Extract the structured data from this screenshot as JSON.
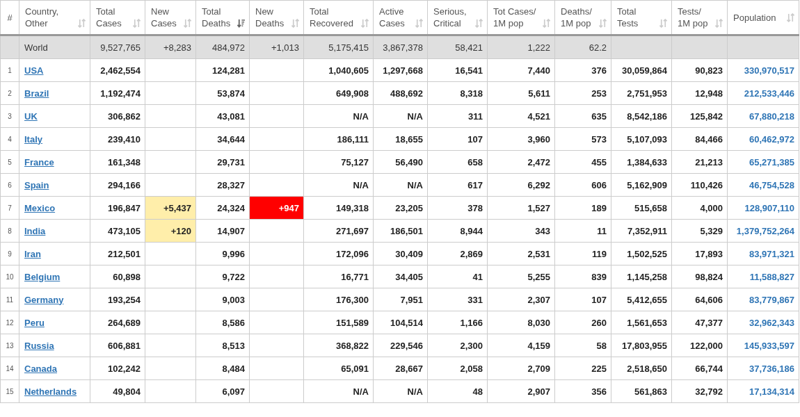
{
  "table": {
    "columns": [
      {
        "label": "#"
      },
      {
        "label": "Country,\nOther",
        "sorted": false
      },
      {
        "label": "Total\nCases",
        "sorted": false
      },
      {
        "label": "New\nCases",
        "sorted": false
      },
      {
        "label": "Total\nDeaths",
        "sorted": true
      },
      {
        "label": "New\nDeaths",
        "sorted": false
      },
      {
        "label": "Total\nRecovered",
        "sorted": false
      },
      {
        "label": "Active\nCases",
        "sorted": false
      },
      {
        "label": "Serious,\nCritical",
        "sorted": false
      },
      {
        "label": "Tot Cases/\n1M pop",
        "sorted": false
      },
      {
        "label": "Deaths/\n1M pop",
        "sorted": false
      },
      {
        "label": "Total\nTests",
        "sorted": false
      },
      {
        "label": "Tests/\n1M pop",
        "sorted": false
      },
      {
        "label": "Population",
        "sorted": false
      }
    ],
    "rows": [
      {
        "kind": "total",
        "country": "World",
        "total_cases": "9,527,765",
        "new_cases": "+8,283",
        "total_deaths": "484,972",
        "new_deaths": "+1,013",
        "total_recovered": "5,175,415",
        "active_cases": "3,867,378",
        "serious_critical": "58,421",
        "cases_per_1m": "1,222",
        "deaths_per_1m": "62.2"
      },
      {
        "kind": "country",
        "rank": "1",
        "country": "USA",
        "total_cases": "2,462,554",
        "total_deaths": "124,281",
        "total_recovered": "1,040,605",
        "active_cases": "1,297,668",
        "serious_critical": "16,541",
        "cases_per_1m": "7,440",
        "deaths_per_1m": "376",
        "total_tests": "30,059,864",
        "tests_per_1m": "90,823",
        "population": "330,970,517",
        "new_cases_highlight": false,
        "new_deaths_highlight": false
      },
      {
        "kind": "country",
        "rank": "2",
        "country": "Brazil",
        "total_cases": "1,192,474",
        "total_deaths": "53,874",
        "total_recovered": "649,908",
        "active_cases": "488,692",
        "serious_critical": "8,318",
        "cases_per_1m": "5,611",
        "deaths_per_1m": "253",
        "total_tests": "2,751,953",
        "tests_per_1m": "12,948",
        "population": "212,533,446",
        "new_cases_highlight": false,
        "new_deaths_highlight": false
      },
      {
        "kind": "country",
        "rank": "3",
        "country": "UK",
        "total_cases": "306,862",
        "total_deaths": "43,081",
        "total_recovered": "N/A",
        "active_cases": "N/A",
        "serious_critical": "311",
        "cases_per_1m": "4,521",
        "deaths_per_1m": "635",
        "total_tests": "8,542,186",
        "tests_per_1m": "125,842",
        "population": "67,880,218",
        "new_cases_highlight": false,
        "new_deaths_highlight": false
      },
      {
        "kind": "country",
        "rank": "4",
        "country": "Italy",
        "total_cases": "239,410",
        "total_deaths": "34,644",
        "total_recovered": "186,111",
        "active_cases": "18,655",
        "serious_critical": "107",
        "cases_per_1m": "3,960",
        "deaths_per_1m": "573",
        "total_tests": "5,107,093",
        "tests_per_1m": "84,466",
        "population": "60,462,972",
        "new_cases_highlight": false,
        "new_deaths_highlight": false
      },
      {
        "kind": "country",
        "rank": "5",
        "country": "France",
        "total_cases": "161,348",
        "total_deaths": "29,731",
        "total_recovered": "75,127",
        "active_cases": "56,490",
        "serious_critical": "658",
        "cases_per_1m": "2,472",
        "deaths_per_1m": "455",
        "total_tests": "1,384,633",
        "tests_per_1m": "21,213",
        "population": "65,271,385",
        "new_cases_highlight": false,
        "new_deaths_highlight": false
      },
      {
        "kind": "country",
        "rank": "6",
        "country": "Spain",
        "total_cases": "294,166",
        "total_deaths": "28,327",
        "total_recovered": "N/A",
        "active_cases": "N/A",
        "serious_critical": "617",
        "cases_per_1m": "6,292",
        "deaths_per_1m": "606",
        "total_tests": "5,162,909",
        "tests_per_1m": "110,426",
        "population": "46,754,528",
        "new_cases_highlight": false,
        "new_deaths_highlight": false
      },
      {
        "kind": "country",
        "rank": "7",
        "country": "Mexico",
        "total_cases": "196,847",
        "new_cases": "+5,437",
        "total_deaths": "24,324",
        "new_deaths": "+947",
        "total_recovered": "149,318",
        "active_cases": "23,205",
        "serious_critical": "378",
        "cases_per_1m": "1,527",
        "deaths_per_1m": "189",
        "total_tests": "515,658",
        "tests_per_1m": "4,000",
        "population": "128,907,110",
        "new_cases_highlight": true,
        "new_deaths_highlight": true
      },
      {
        "kind": "country",
        "rank": "8",
        "country": "India",
        "total_cases": "473,105",
        "new_cases": "+120",
        "total_deaths": "14,907",
        "total_recovered": "271,697",
        "active_cases": "186,501",
        "serious_critical": "8,944",
        "cases_per_1m": "343",
        "deaths_per_1m": "11",
        "total_tests": "7,352,911",
        "tests_per_1m": "5,329",
        "population": "1,379,752,264",
        "new_cases_highlight": true,
        "new_deaths_highlight": false
      },
      {
        "kind": "country",
        "rank": "9",
        "country": "Iran",
        "total_cases": "212,501",
        "total_deaths": "9,996",
        "total_recovered": "172,096",
        "active_cases": "30,409",
        "serious_critical": "2,869",
        "cases_per_1m": "2,531",
        "deaths_per_1m": "119",
        "total_tests": "1,502,525",
        "tests_per_1m": "17,893",
        "population": "83,971,321",
        "new_cases_highlight": false,
        "new_deaths_highlight": false
      },
      {
        "kind": "country",
        "rank": "10",
        "country": "Belgium",
        "total_cases": "60,898",
        "total_deaths": "9,722",
        "total_recovered": "16,771",
        "active_cases": "34,405",
        "serious_critical": "41",
        "cases_per_1m": "5,255",
        "deaths_per_1m": "839",
        "total_tests": "1,145,258",
        "tests_per_1m": "98,824",
        "population": "11,588,827",
        "new_cases_highlight": false,
        "new_deaths_highlight": false
      },
      {
        "kind": "country",
        "rank": "11",
        "country": "Germany",
        "total_cases": "193,254",
        "total_deaths": "9,003",
        "total_recovered": "176,300",
        "active_cases": "7,951",
        "serious_critical": "331",
        "cases_per_1m": "2,307",
        "deaths_per_1m": "107",
        "total_tests": "5,412,655",
        "tests_per_1m": "64,606",
        "population": "83,779,867",
        "new_cases_highlight": false,
        "new_deaths_highlight": false
      },
      {
        "kind": "country",
        "rank": "12",
        "country": "Peru",
        "total_cases": "264,689",
        "total_deaths": "8,586",
        "total_recovered": "151,589",
        "active_cases": "104,514",
        "serious_critical": "1,166",
        "cases_per_1m": "8,030",
        "deaths_per_1m": "260",
        "total_tests": "1,561,653",
        "tests_per_1m": "47,377",
        "population": "32,962,343",
        "new_cases_highlight": false,
        "new_deaths_highlight": false
      },
      {
        "kind": "country",
        "rank": "13",
        "country": "Russia",
        "total_cases": "606,881",
        "total_deaths": "8,513",
        "total_recovered": "368,822",
        "active_cases": "229,546",
        "serious_critical": "2,300",
        "cases_per_1m": "4,159",
        "deaths_per_1m": "58",
        "total_tests": "17,803,955",
        "tests_per_1m": "122,000",
        "population": "145,933,597",
        "new_cases_highlight": false,
        "new_deaths_highlight": false
      },
      {
        "kind": "country",
        "rank": "14",
        "country": "Canada",
        "total_cases": "102,242",
        "total_deaths": "8,484",
        "total_recovered": "65,091",
        "active_cases": "28,667",
        "serious_critical": "2,058",
        "cases_per_1m": "2,709",
        "deaths_per_1m": "225",
        "total_tests": "2,518,650",
        "tests_per_1m": "66,744",
        "population": "37,736,186",
        "new_cases_highlight": false,
        "new_deaths_highlight": false
      },
      {
        "kind": "country",
        "rank": "15",
        "country": "Netherlands",
        "total_cases": "49,804",
        "total_deaths": "6,097",
        "total_recovered": "N/A",
        "active_cases": "N/A",
        "serious_critical": "48",
        "cases_per_1m": "2,907",
        "deaths_per_1m": "356",
        "total_tests": "561,863",
        "tests_per_1m": "32,792",
        "population": "17,134,314",
        "new_cases_highlight": false,
        "new_deaths_highlight": false
      }
    ]
  }
}
